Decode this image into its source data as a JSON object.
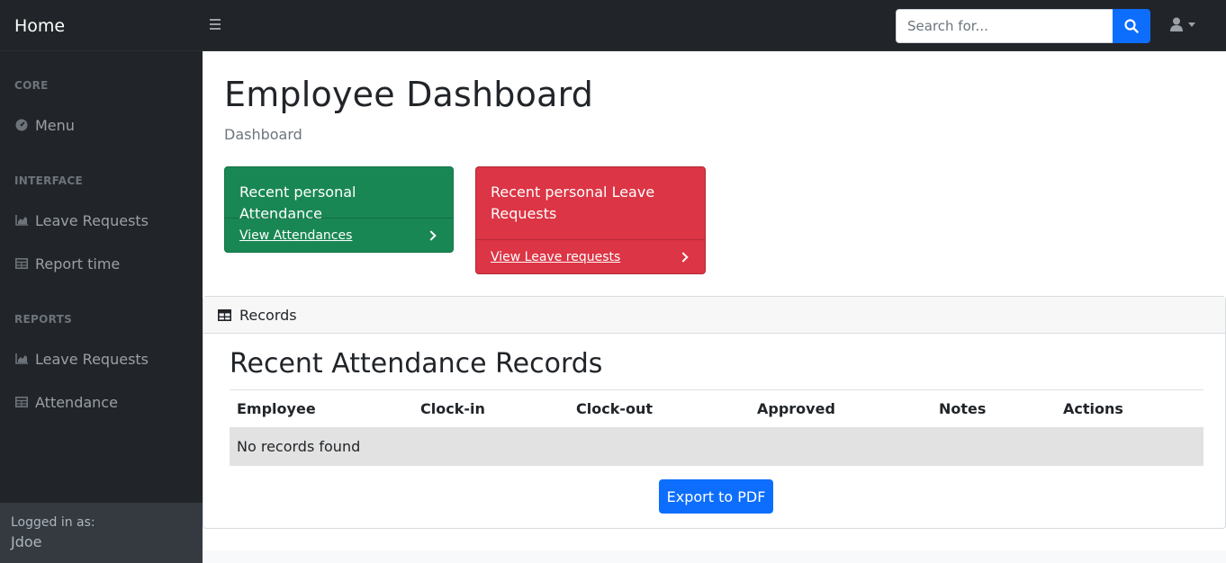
{
  "navbar": {
    "brand": "Home",
    "search": {
      "placeholder": "Search for...",
      "value": ""
    }
  },
  "sidebar": {
    "sections": [
      {
        "heading": "CORE",
        "items": [
          {
            "label": "Menu",
            "icon": "tachometer-icon"
          }
        ]
      },
      {
        "heading": "INTERFACE",
        "items": [
          {
            "label": "Leave Requests",
            "icon": "area-chart-icon"
          },
          {
            "label": "Report time",
            "icon": "table-icon"
          }
        ]
      },
      {
        "heading": "REPORTS",
        "items": [
          {
            "label": "Leave Requests",
            "icon": "area-chart-icon"
          },
          {
            "label": "Attendance",
            "icon": "table-icon"
          }
        ]
      }
    ],
    "footer": {
      "label": "Logged in as:",
      "user": "Jdoe"
    }
  },
  "main": {
    "title": "Employee Dashboard",
    "breadcrumb": "Dashboard",
    "cards": [
      {
        "title": "Recent personal Attendance",
        "link": "View Attendances",
        "color": "#198754"
      },
      {
        "title": "Recent personal Leave Requests",
        "link": "View Leave requests",
        "color": "#dc3545"
      }
    ],
    "records": {
      "header": "Records",
      "title": "Recent Attendance Records",
      "columns": [
        "Employee",
        "Clock-in",
        "Clock-out",
        "Approved",
        "Notes",
        "Actions"
      ],
      "empty_message": "No records found",
      "export_label": "Export to PDF"
    }
  },
  "colors": {
    "primary": "#0d6efd",
    "dark": "#212529",
    "success": "#198754",
    "danger": "#dc3545"
  }
}
